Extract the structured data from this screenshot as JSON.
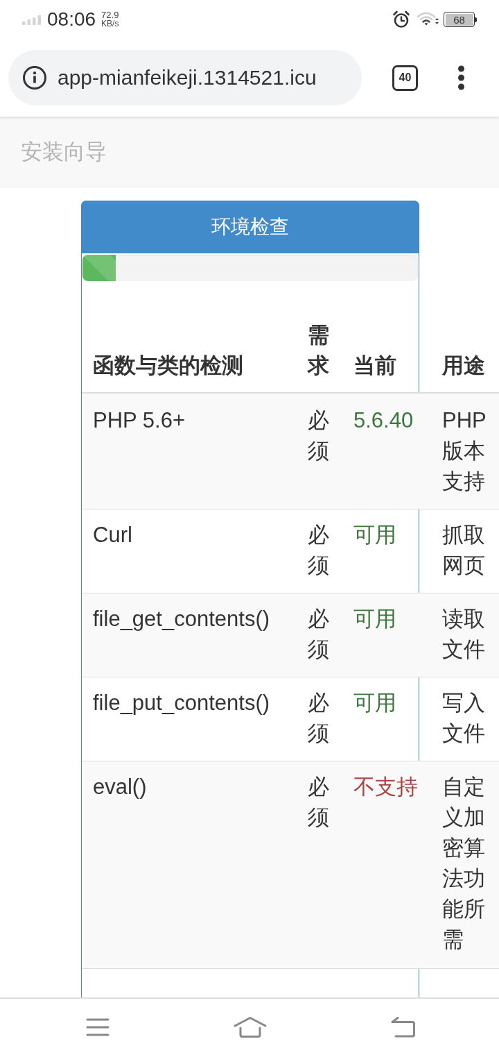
{
  "status_bar": {
    "time": "08:06",
    "net_speed": "72.9",
    "net_speed_unit": "KB/s",
    "battery": "68"
  },
  "browser": {
    "url": "app-mianfeikeji.1314521.icu",
    "tab_count": "40"
  },
  "navbar": {
    "brand": "安装向导"
  },
  "panel": {
    "title": "环境检查",
    "progress": {
      "level": 0.1
    }
  },
  "table": {
    "columns": [
      "函数与类的检测",
      "需求",
      "当前",
      "用途"
    ],
    "rows": [
      {
        "name": "PHP 5.6+",
        "requirement": "必须",
        "current": "5.6.40",
        "supported": true,
        "purpose": "PHP版本支持"
      },
      {
        "name": "Curl",
        "requirement": "必须",
        "current": "可用",
        "supported": true,
        "purpose": "抓取网页"
      },
      {
        "name": "file_get_contents()",
        "requirement": "必须",
        "current": "可用",
        "supported": true,
        "purpose": "读取文件"
      },
      {
        "name": "file_put_contents()",
        "requirement": "必须",
        "current": "可用",
        "supported": true,
        "purpose": "写入文件"
      },
      {
        "name": "eval()",
        "requirement": "必须",
        "current": "不支持",
        "supported": false,
        "purpose": "自定义加密算法功能所需"
      }
    ]
  }
}
